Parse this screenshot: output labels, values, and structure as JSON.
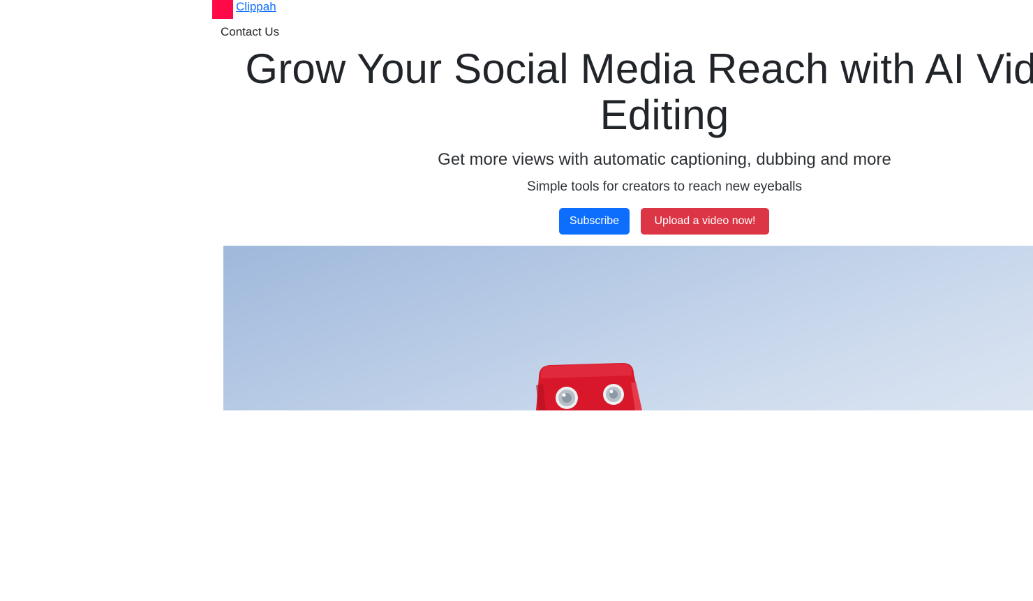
{
  "header": {
    "brand_name": "Clippah",
    "contact_label": "Contact Us"
  },
  "hero": {
    "title": "Grow Your Social Media Reach with AI Video Editing",
    "subtitle": "Get more views with automatic captioning, dubbing and more",
    "tagline": "Simple tools for creators to reach new eyeballs"
  },
  "actions": {
    "subscribe_label": "Subscribe",
    "upload_label": "Upload a video now!"
  },
  "colors": {
    "brand_logo": "#ff0a47",
    "link": "#0d6efd",
    "subscribe_button": "#0d6efd",
    "upload_button": "#dc3545",
    "robot": "#d8182a"
  },
  "icons": {
    "brand_logo": "clippah-logo-icon"
  }
}
